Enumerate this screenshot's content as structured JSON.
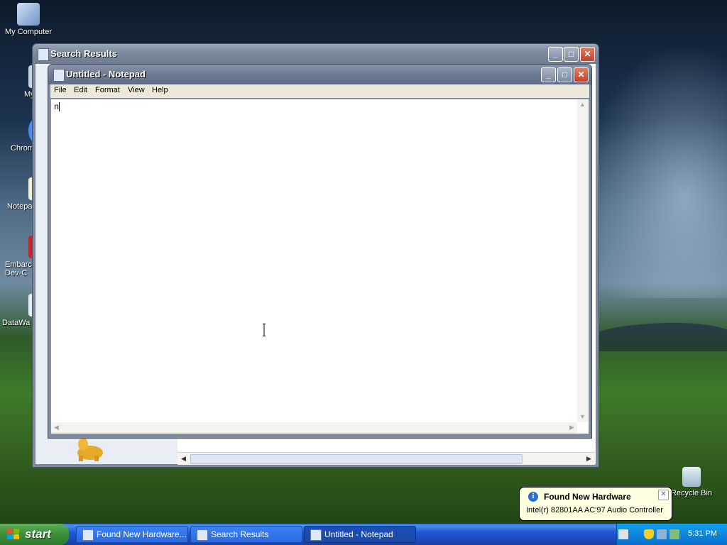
{
  "desktop": {
    "icons": [
      {
        "label": "My Computer"
      },
      {
        "label": "MyPa"
      },
      {
        "label": "Chrom"
      },
      {
        "label": "Notepa"
      },
      {
        "label": "Embarca\nDev-C"
      },
      {
        "label": "DataWa"
      },
      {
        "label": "Recycle Bin"
      }
    ]
  },
  "search_window": {
    "title": "Search Results"
  },
  "notepad": {
    "title": "Untitled - Notepad",
    "menu": [
      "File",
      "Edit",
      "Format",
      "View",
      "Help"
    ],
    "text": "n"
  },
  "balloon": {
    "title": "Found New Hardware",
    "text": "Intel(r) 82801AA AC'97 Audio Controller"
  },
  "taskbar": {
    "start_label": "start",
    "tasks": [
      {
        "label": "Found New Hardware..."
      },
      {
        "label": "Search Results"
      },
      {
        "label": "Untitled - Notepad"
      }
    ],
    "clock": "5:31 PM"
  },
  "colors": {
    "taskbar_blue": "#245edb",
    "start_green": "#3c8f3b",
    "balloon_bg": "#ffffe1"
  }
}
